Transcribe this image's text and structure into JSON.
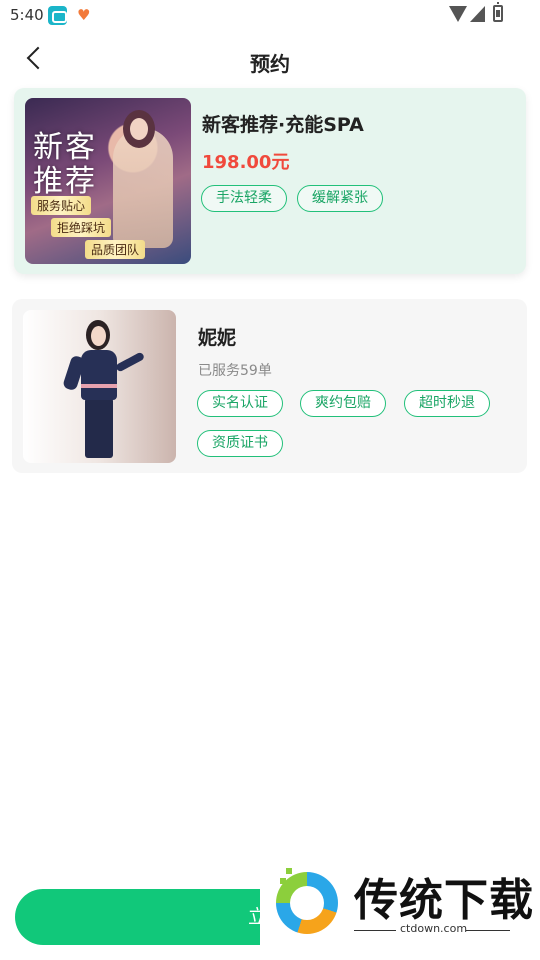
{
  "status_bar": {
    "time": "5:40"
  },
  "header": {
    "title": "预约"
  },
  "service": {
    "name": "新客推荐·充能SPA",
    "price": "198.00元",
    "tags": [
      "手法轻柔",
      "缓解紧张"
    ],
    "thumbnail": {
      "headline_line1": "新客",
      "headline_line2": "推荐",
      "badges": [
        "服务贴心",
        "拒绝踩坑",
        "品质团队"
      ]
    }
  },
  "therapist": {
    "name": "妮妮",
    "served": "已服务59单",
    "tags": [
      "实名认证",
      "爽约包赔",
      "超时秒退",
      "资质证书"
    ]
  },
  "footer": {
    "book_button_label": "立即"
  },
  "watermark": {
    "brand": "传统下载",
    "url": "ctdown.com"
  },
  "colors": {
    "accent": "#11c87a",
    "price": "#f0493c",
    "card_bg": "#e6f5ee"
  }
}
